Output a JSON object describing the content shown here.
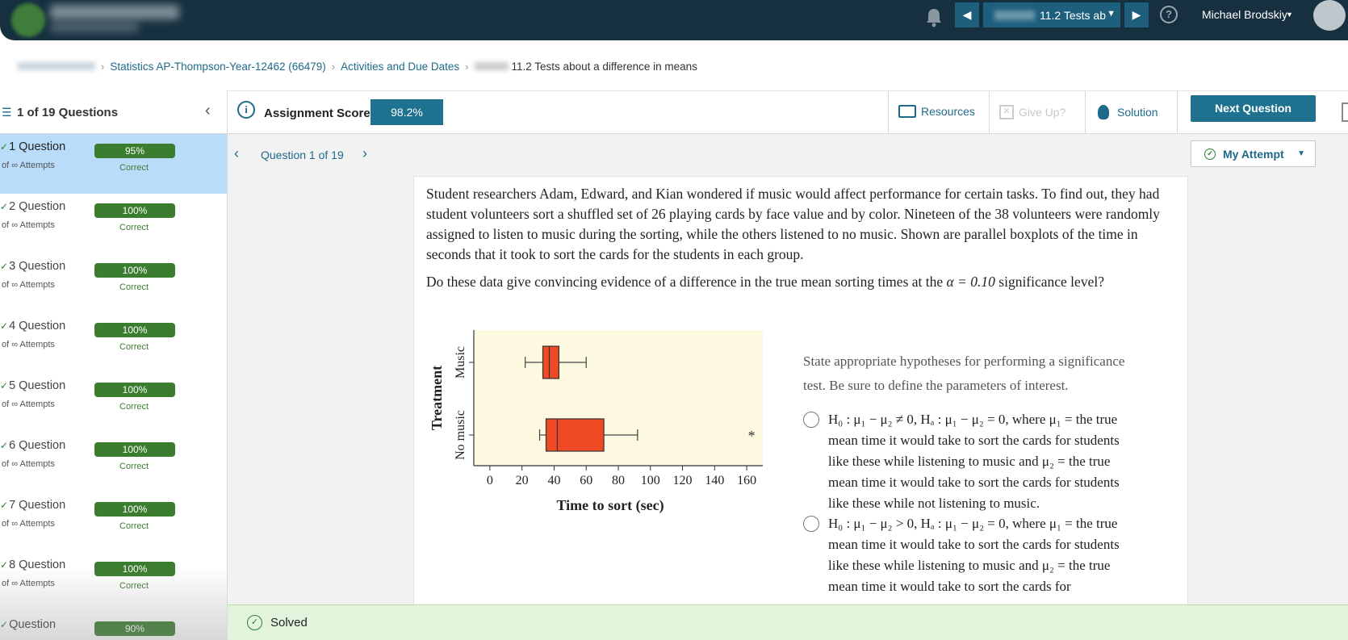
{
  "topbar": {
    "select_label": "11.2 Tests ab",
    "prev_icon": "◀",
    "next_icon": "▶",
    "username": "Michael Brodskiy"
  },
  "breadcrumb": {
    "course": "Statistics AP-Thompson-Year-12462 (66479)",
    "activities": "Activities and Due Dates",
    "current": "11.2 Tests about a difference in means"
  },
  "sidebar": {
    "title": "1 of 19 Questions",
    "questions": [
      {
        "label": "1 Question",
        "score": "95%",
        "attempts": "of ∞ Attempts",
        "status": "Correct"
      },
      {
        "label": "2 Question",
        "score": "100%",
        "attempts": "of ∞ Attempts",
        "status": "Correct"
      },
      {
        "label": "3 Question",
        "score": "100%",
        "attempts": "of ∞ Attempts",
        "status": "Correct"
      },
      {
        "label": "4 Question",
        "score": "100%",
        "attempts": "of ∞ Attempts",
        "status": "Correct"
      },
      {
        "label": "5 Question",
        "score": "100%",
        "attempts": "of ∞ Attempts",
        "status": "Correct"
      },
      {
        "label": "6 Question",
        "score": "100%",
        "attempts": "of ∞ Attempts",
        "status": "Correct"
      },
      {
        "label": "7 Question",
        "score": "100%",
        "attempts": "of ∞ Attempts",
        "status": "Correct"
      },
      {
        "label": "8 Question",
        "score": "100%",
        "attempts": "of ∞ Attempts",
        "status": "Correct"
      },
      {
        "label": "Question",
        "score": "90%",
        "attempts": "",
        "status": ""
      }
    ]
  },
  "toolbar": {
    "score_label": "Assignment Score:",
    "score_value": "98.2%",
    "resources": "Resources",
    "give_up": "Give Up?",
    "solution": "Solution",
    "next_question": "Next Question"
  },
  "question": {
    "nav_label": "Question 1 of 19",
    "attempt_label": "My Attempt",
    "text1": "Student researchers Adam, Edward, and Kian wondered if music would affect performance for certain tasks. To find out, they had student volunteers sort a shuffled set of 26 playing cards by face value and by color. Nineteen of the 38 volunteers were randomly assigned to listen to music during the sorting, while the others listened to no music. Shown are parallel boxplots of the time in seconds that it took to sort the cards for the students in each group.",
    "text2_pre": "Do these data give convincing evidence of a difference in the true mean sorting times at the ",
    "text2_math": "α = 0.10",
    "text2_post": " significance level?",
    "prompt": "State appropriate hypotheses for performing a significance test. Be sure to define the parameters of interest.",
    "option1": "H₀ : μ₁ − μ₂ ≠ 0, Hₐ : μ₁ − μ₂ = 0, where μ₁ = the true mean time it would take to sort the cards for students like these while listening to music and μ₂ = the true mean time it would take to sort the cards for students like these while not listening to music.",
    "option2": "H₀ : μ₁ − μ₂ > 0, Hₐ : μ₁ − μ₂ = 0, where μ₁ = the true mean time it would take to sort the cards for students like these while listening to music and μ₂ = the true mean time it would take to sort the cards for"
  },
  "chart_data": {
    "type": "boxplot",
    "xlabel": "Time to sort (sec)",
    "ylabel": "Treatment",
    "xlim": [
      -10,
      170
    ],
    "xticks": [
      0,
      20,
      40,
      60,
      80,
      100,
      120,
      140,
      160
    ],
    "background": "#fdf8e0",
    "box_color": "#f04a24",
    "series": [
      {
        "name": "Music",
        "min": 22,
        "q1": 33,
        "median": 37,
        "q3": 43,
        "max": 60,
        "outliers": []
      },
      {
        "name": "No music",
        "min": 31,
        "q1": 35,
        "median": 42,
        "q3": 71,
        "max": 92,
        "outliers": [
          163
        ]
      }
    ]
  },
  "footer": {
    "solved": "Solved"
  },
  "colors": {
    "topbar": "#16303f",
    "accent": "#1e7290",
    "badge_green": "#3b7d2f",
    "active_row": "#b8dcf9",
    "solved_bg": "#e2f4dc"
  }
}
